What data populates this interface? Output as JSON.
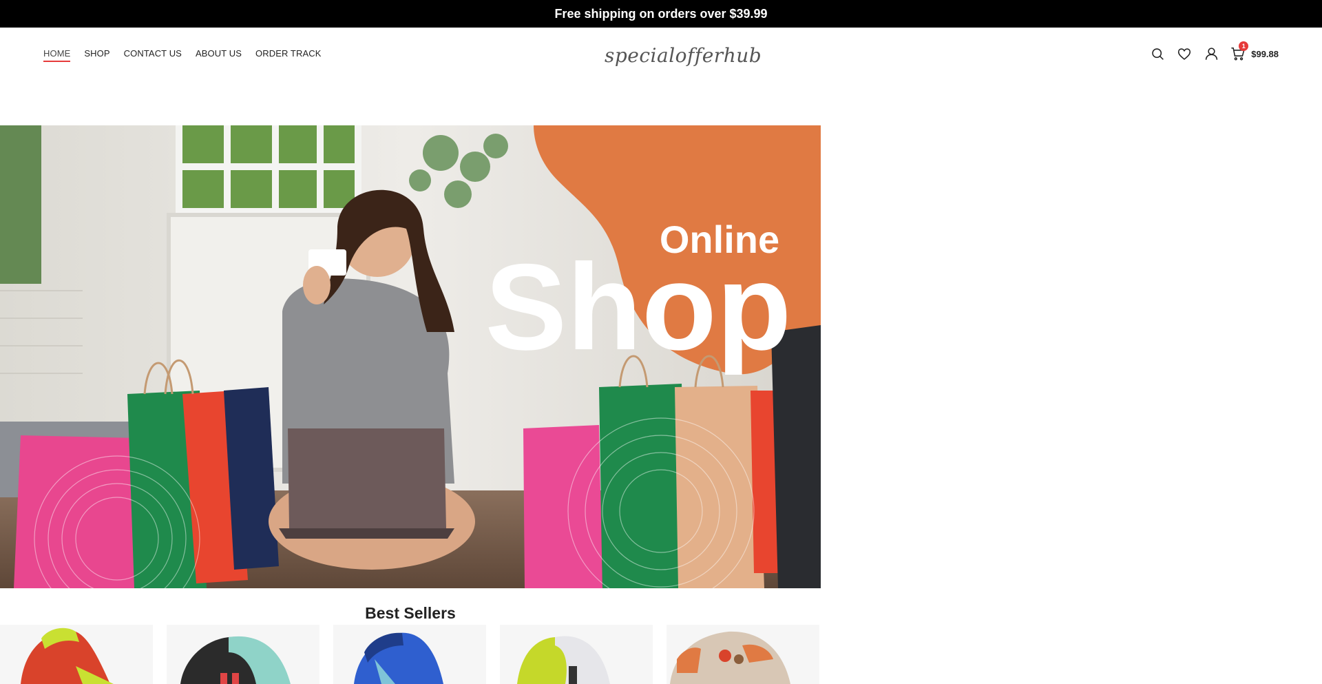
{
  "topbar": {
    "text": "Free shipping on orders over $39.99"
  },
  "nav": {
    "items": [
      {
        "label": "HOME",
        "active": true
      },
      {
        "label": "SHOP",
        "active": false
      },
      {
        "label": "CONTACT US",
        "active": false
      },
      {
        "label": "ABOUT US",
        "active": false
      },
      {
        "label": "ORDER TRACK",
        "active": false
      }
    ]
  },
  "logo": {
    "text": "specialofferhub"
  },
  "header_actions": {
    "icons": [
      "search-icon",
      "heart-icon",
      "user-icon",
      "cart-icon"
    ],
    "cart_count": "1",
    "cart_total": "$99.88"
  },
  "hero": {
    "word_small": "Online",
    "word_large": "Shop",
    "accent_color": "#e07a43"
  },
  "best_sellers": {
    "title": "Best Sellers",
    "products": [
      {
        "name": "shoe-1",
        "colors": [
          "#d9432b",
          "#c9e032"
        ]
      },
      {
        "name": "shoe-2",
        "colors": [
          "#2b2b2b",
          "#8fd3c8"
        ]
      },
      {
        "name": "shoe-3",
        "colors": [
          "#2f5fcf",
          "#7fc4d8"
        ]
      },
      {
        "name": "shoe-4",
        "colors": [
          "#e6e6ea",
          "#c5d82a"
        ]
      },
      {
        "name": "shoe-5",
        "colors": [
          "#d8c7b5",
          "#e07a43"
        ]
      }
    ]
  },
  "colors": {
    "accent": "#e63a3a",
    "topbar_bg": "#000000"
  }
}
